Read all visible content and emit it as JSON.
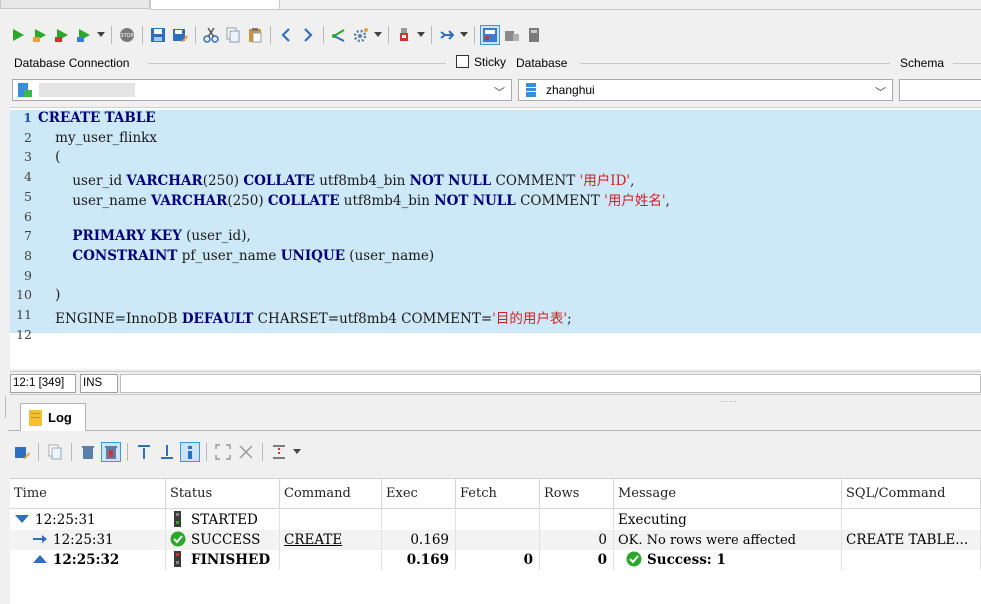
{
  "toolbar": {
    "icons": [
      "execute-icon",
      "execute-current-icon",
      "execute-selection-icon",
      "execute-script-icon",
      "dropdown-icon",
      "stop-icon",
      "save-icon",
      "save-as-icon",
      "cut-icon",
      "copy-icon",
      "paste-icon",
      "back-icon",
      "forward-icon",
      "share-icon",
      "settings-icon",
      "dropdown-icon",
      "tools-icon",
      "dropdown-icon",
      "goto-icon",
      "dropdown-icon",
      "panel-layout-icon",
      "panel-grid-icon",
      "panel-misc-icon"
    ]
  },
  "connection": {
    "database_connection_label": "Database Connection",
    "sticky_label": "Sticky",
    "database_label": "Database",
    "schema_label": "Schema",
    "database_value": "zhanghui"
  },
  "editor": {
    "lines": [
      {
        "n": "1",
        "text": "CREATE TABLE"
      },
      {
        "n": "2",
        "text": "    my_user_flinkx"
      },
      {
        "n": "3",
        "text": "    ("
      },
      {
        "n": "4",
        "text": "        user_id VARCHAR(250) COLLATE utf8mb4_bin NOT NULL COMMENT '用户ID',"
      },
      {
        "n": "5",
        "text": "        user_name VARCHAR(250) COLLATE utf8mb4_bin NOT NULL COMMENT '用户姓名',"
      },
      {
        "n": "6",
        "text": ""
      },
      {
        "n": "7",
        "text": "        PRIMARY KEY (user_id),"
      },
      {
        "n": "8",
        "text": "        CONSTRAINT pf_user_name UNIQUE (user_name)"
      },
      {
        "n": "9",
        "text": ""
      },
      {
        "n": "10",
        "text": "    )"
      },
      {
        "n": "11",
        "text": "    ENGINE=InnoDB DEFAULT CHARSET=utf8mb4 COMMENT='目的用户表';"
      },
      {
        "n": "12",
        "text": ""
      }
    ]
  },
  "status": {
    "position": "12:1 [349]",
    "mode": "INS"
  },
  "log": {
    "tab_label": "Log",
    "columns": [
      "Time",
      "Status",
      "Command",
      "Exec",
      "Fetch",
      "Rows",
      "Message",
      "SQL/Command"
    ],
    "rows": [
      {
        "time": "12:25:31",
        "status": "STARTED",
        "command": "",
        "exec": "",
        "fetch": "",
        "rows": "",
        "message": "Executing",
        "sql": ""
      },
      {
        "time": "12:25:31",
        "status": "SUCCESS",
        "command": "CREATE",
        "exec": "0.169",
        "fetch": "",
        "rows": "0",
        "message": "OK. No rows were affected",
        "sql": "CREATE TABLE..."
      },
      {
        "time": "12:25:32",
        "status": "FINISHED",
        "command": "",
        "exec": "0.169",
        "fetch": "0",
        "rows": "0",
        "message": "Success: 1",
        "sql": ""
      }
    ]
  }
}
